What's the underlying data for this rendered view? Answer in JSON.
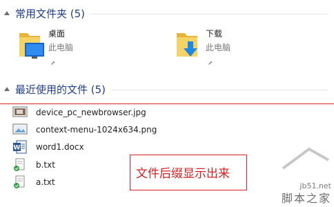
{
  "frequent_folders": {
    "header": "常用文件夹 (5)",
    "items": [
      {
        "name": "桌面",
        "location": "此电脑",
        "icon": "desktop-folder-icon"
      },
      {
        "name": "下载",
        "location": "此电脑",
        "icon": "downloads-folder-icon"
      }
    ]
  },
  "recent_files": {
    "header": "最近使用的文件 (5)",
    "items": [
      {
        "name": "device_pc_newbrowser.jpg",
        "icon": "image-file-icon"
      },
      {
        "name": "context-menu-1024x634.png",
        "icon": "image-file-icon"
      },
      {
        "name": "word1.docx",
        "icon": "word-document-icon"
      },
      {
        "name": "b.txt",
        "icon": "text-file-icon"
      },
      {
        "name": "a.txt",
        "icon": "text-file-icon"
      }
    ]
  },
  "annotation": {
    "text": "文件后缀显示出来"
  },
  "watermark": {
    "site": "jb51.net",
    "brand": "脚本之家"
  },
  "colors": {
    "header": "#1f3d8c",
    "annotation": "#d71f1f",
    "folder": "#f2c94c",
    "accent": "#1e88e5"
  }
}
